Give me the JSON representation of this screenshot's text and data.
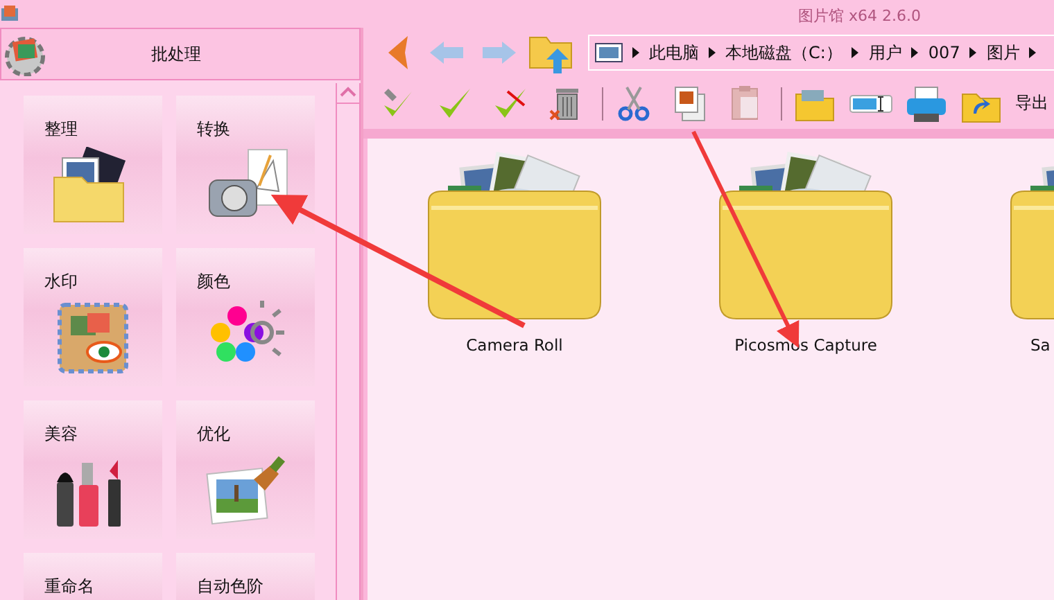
{
  "window": {
    "title": "图片馆 x64 2.6.0"
  },
  "sidebar": {
    "title": "批处理",
    "tiles": [
      {
        "label": "整理",
        "kind": "organize"
      },
      {
        "label": "转换",
        "kind": "convert"
      },
      {
        "label": "水印",
        "kind": "watermark"
      },
      {
        "label": "颜色",
        "kind": "color"
      },
      {
        "label": "美容",
        "kind": "beauty"
      },
      {
        "label": "优化",
        "kind": "optimize"
      },
      {
        "label": "重命名",
        "kind": "rename"
      },
      {
        "label": "自动色阶",
        "kind": "levels"
      }
    ]
  },
  "breadcrumb": [
    "此电脑",
    "本地磁盘（C:）",
    "用户",
    "007",
    "图片"
  ],
  "toolbar": {
    "export_label": "导出"
  },
  "folders": [
    {
      "name": "Camera Roll"
    },
    {
      "name": "Picosmos Capture"
    },
    {
      "name": "Sa"
    }
  ]
}
